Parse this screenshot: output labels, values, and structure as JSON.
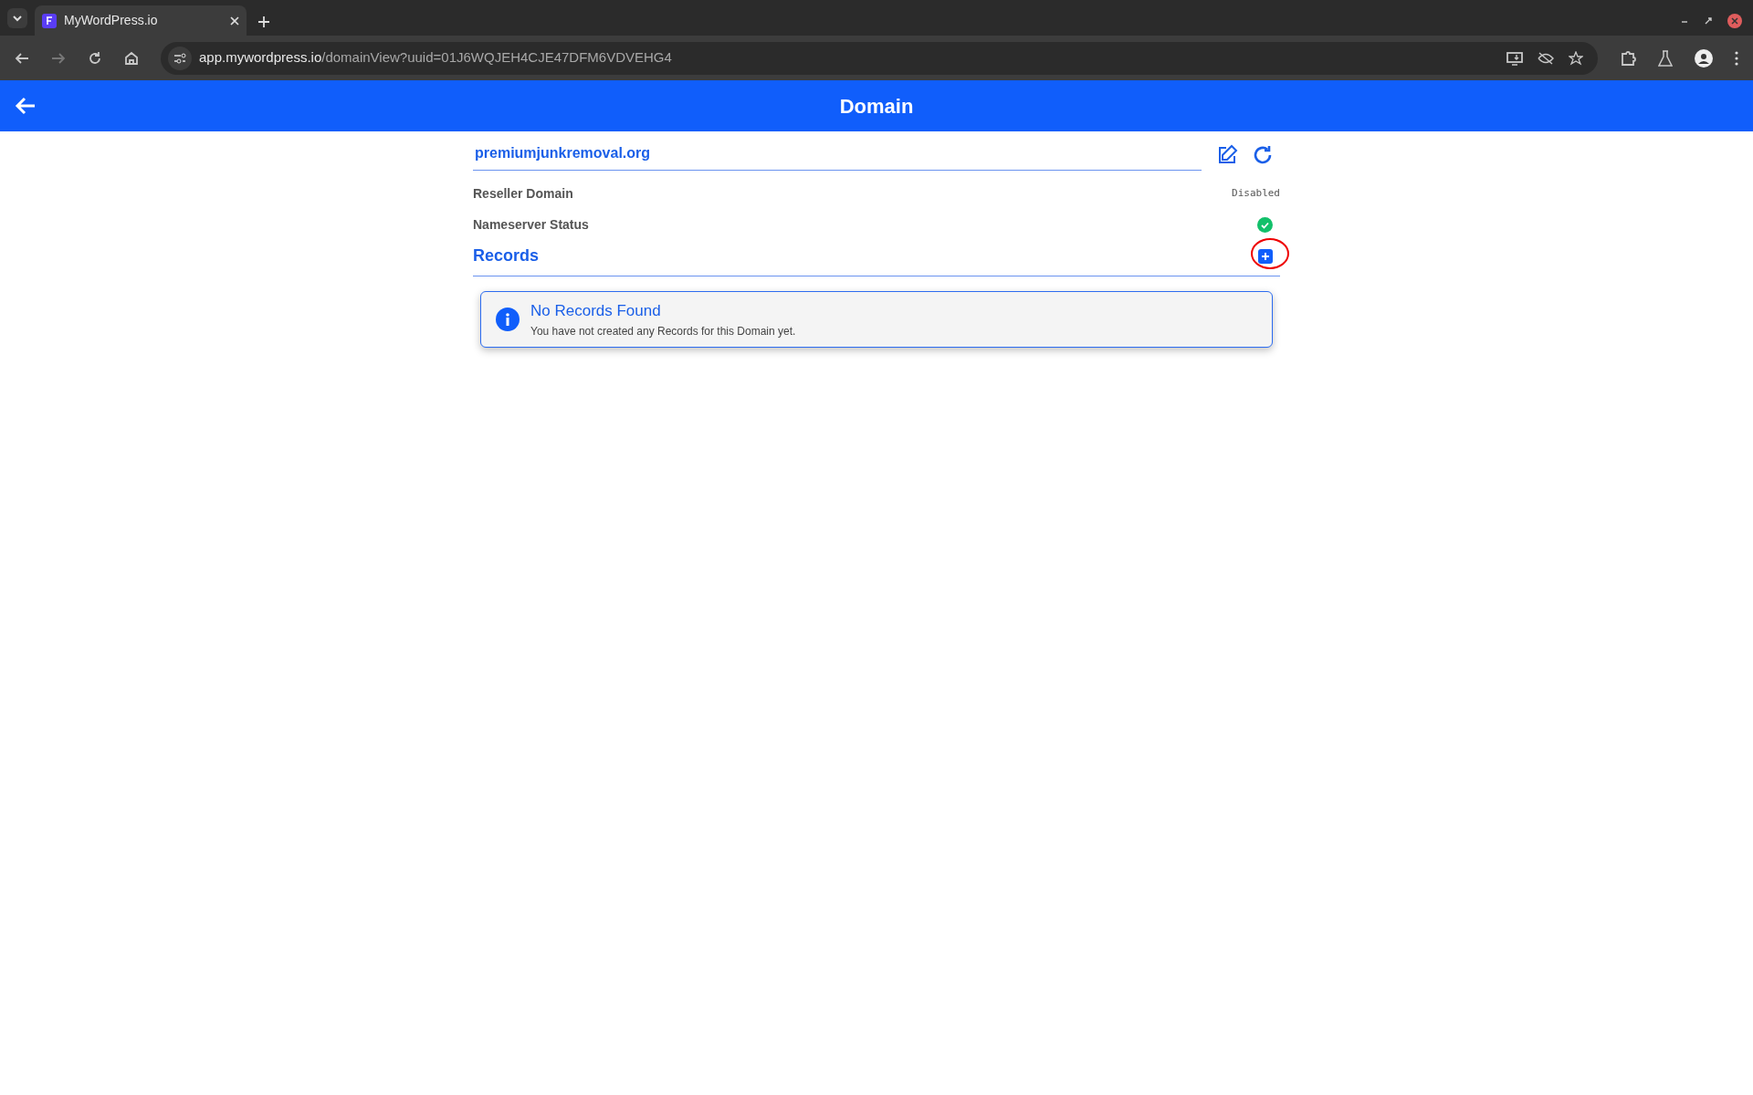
{
  "browser": {
    "tab": {
      "title": "MyWordPress.io",
      "selected": true
    },
    "url_host": "app.mywordpress.io",
    "url_path": "/domainView?uuid=01J6WQJEH4CJE47DFM6VDVEHG4"
  },
  "header": {
    "title": "Domain"
  },
  "domain": {
    "name": "premiumjunkremoval.org"
  },
  "fields": [
    {
      "label": "Reseller Domain",
      "kind": "text",
      "value": "Disabled"
    },
    {
      "label": "Nameserver Status",
      "kind": "status",
      "ok": true
    }
  ],
  "records": {
    "title": "Records",
    "add_highlighted": true,
    "alert": {
      "title": "No Records Found",
      "message": "You have not created any Records for this Domain yet."
    }
  }
}
